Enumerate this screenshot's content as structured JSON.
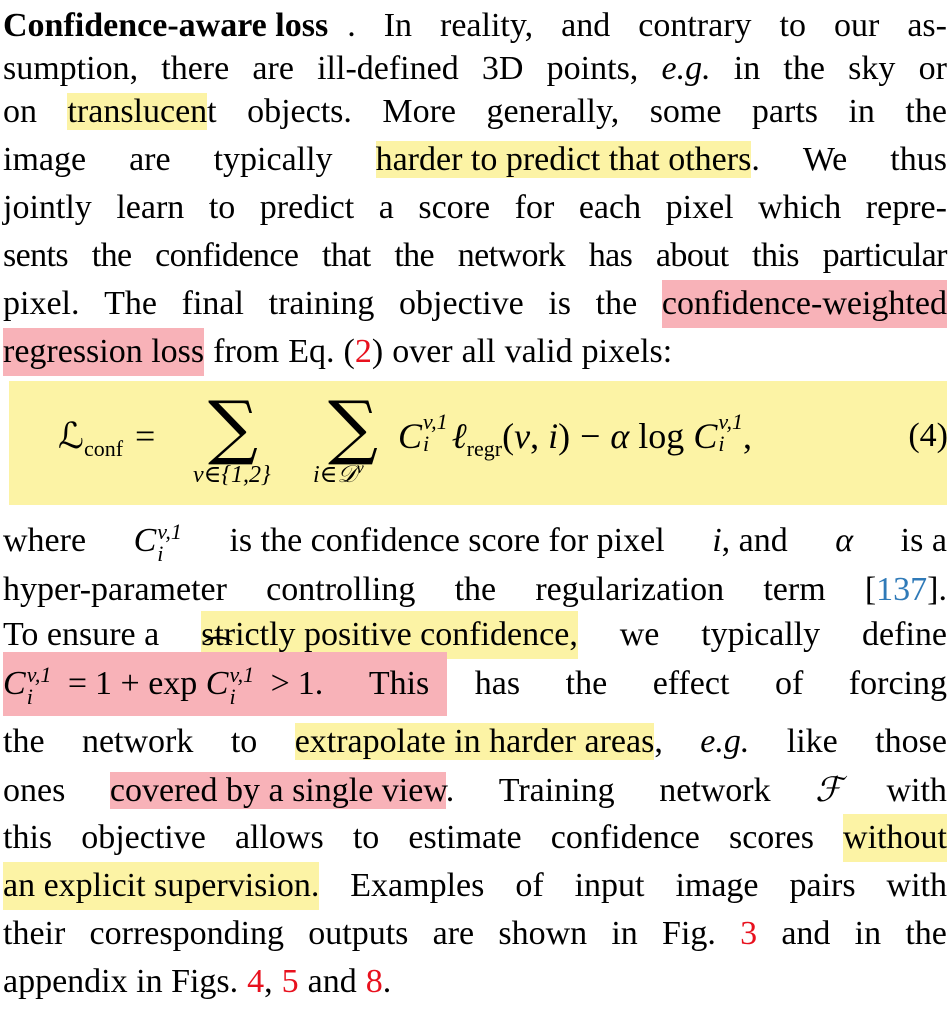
{
  "heading": "Confidence-aware loss",
  "lines": [
    [
      "In",
      "reality,",
      "and",
      "contrary",
      "to",
      "our",
      "as-"
    ],
    [
      "sumption,",
      "there",
      "are",
      "ill-defined",
      "3D",
      "points,",
      "e.g.",
      "in",
      "the",
      "sky",
      "or"
    ],
    [
      "on",
      "translucent",
      "objects.",
      "More",
      "generally,",
      "some",
      "parts",
      "in",
      "the"
    ],
    [
      "image",
      "are",
      "typically",
      "harder to predict that others.",
      "We",
      "thus"
    ],
    [
      "jointly",
      "learn",
      "to",
      "predict",
      "a",
      "score",
      "for",
      "each",
      "pixel",
      "which",
      "repre-"
    ],
    [
      "sents",
      "the",
      "confidence",
      "that",
      "the",
      "network",
      "has",
      "about",
      "this",
      "particular"
    ],
    [
      "pixel.",
      "The",
      "final",
      "training",
      "objective",
      "is",
      "the",
      "confidence-weighted"
    ],
    [
      "regression loss",
      "from",
      "Eq.",
      "(2)",
      "over",
      "all",
      "valid",
      "pixels:"
    ]
  ],
  "text": {
    "l1_rest": [
      "In",
      "reality,",
      "and",
      "contrary",
      "to",
      "our",
      "as-"
    ],
    "l2": [
      "sumption,",
      "there",
      "are",
      "ill-defined",
      "3D",
      "points,"
    ],
    "l2_eg": "e.g.",
    "l2_end": [
      "in",
      "the",
      "sky",
      "or"
    ],
    "l3_a": "on",
    "l3_hl": "translucen",
    "l3_t": "t",
    "l3_rest": [
      "objects.",
      "More",
      "generally,",
      "some",
      "parts",
      "in",
      "the"
    ],
    "l4_a": [
      "image",
      "are",
      "typically"
    ],
    "l4_hl": "harder to predict that others",
    "l4_rest": [
      ".",
      "We",
      "thus"
    ],
    "l5": [
      "jointly",
      "learn",
      "to",
      "predict",
      "a",
      "score",
      "for",
      "each",
      "pixel",
      "which",
      "repre-"
    ],
    "l6": [
      "sents",
      "the",
      "confidence",
      "that",
      "the",
      "network",
      "has",
      "about",
      "this",
      "particular"
    ],
    "l7_a": [
      "pixel.",
      "The",
      "final",
      "training",
      "objective",
      "is",
      "the"
    ],
    "l7_hl": "confidence-weighted",
    "l8_hl": "regression loss",
    "l8_rest_a": [
      "from",
      "Eq."
    ],
    "l8_ref": "2",
    "l8_rest_b": [
      "over",
      "all",
      "valid",
      "pixels:"
    ],
    "eq_number": "(4)",
    "l9_a": "where",
    "l9_b": "is the confidence score for pixel",
    "l9_c": ", and",
    "l9_d": "is a",
    "l10_a": [
      "hyper-parameter",
      "controlling",
      "the",
      "regularization",
      "term"
    ],
    "l10_ref": "137",
    "l11_a": "To ensure a",
    "l11_hl": "strictly positive confidence,",
    "l11_rest": [
      "we",
      "typically",
      "define"
    ],
    "l12_rest": [
      "This",
      "has",
      "the",
      "effect",
      "of",
      "forcing"
    ],
    "l13_a": [
      "the",
      "network",
      "to"
    ],
    "l13_hl": "extrapolate in harder areas",
    "l13_b": ",",
    "l13_eg": "e.g.",
    "l13_rest": [
      "like",
      "those"
    ],
    "l14_a": "ones",
    "l14_hl": "covered by a single view",
    "l14_rest": [
      ".",
      "Training",
      "network",
      "with"
    ],
    "l15_a": [
      "this",
      "objective",
      "allows",
      "to",
      "estimate",
      "confidence",
      "scores"
    ],
    "l15_hl": "without",
    "l16_hl": "an explicit supervision.",
    "l16_rest": [
      "Examples",
      "of",
      "input",
      "image",
      "pairs",
      "with"
    ],
    "l17_a": [
      "their",
      "corresponding",
      "outputs",
      "are",
      "shown",
      "in",
      "Fig."
    ],
    "l17_ref": "3",
    "l17_rest": [
      "and",
      "in",
      "the"
    ],
    "l18_a": "appendix in Figs.",
    "l18_ref1": "4",
    "l18_ref2": "5",
    "l18_and": "and",
    "l18_ref3": "8"
  },
  "colors": {
    "highlight_yellow": "#fcf3a5",
    "highlight_red": "#f8b2b8",
    "ref_red": "#e8111e",
    "ref_blue": "#2f7ab8"
  }
}
